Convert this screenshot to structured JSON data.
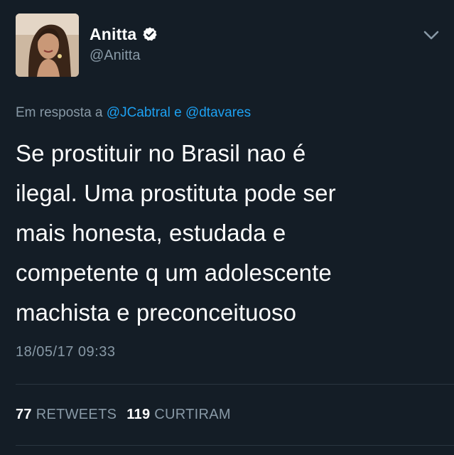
{
  "author": {
    "display_name": "Anitta",
    "handle": "@Anitta",
    "verified_icon": "verified-badge-icon",
    "avatar": "profile-photo"
  },
  "menu_icon": "chevron-down-icon",
  "reply": {
    "prefix": "Em resposta a ",
    "mention_1": "@JCabtral",
    "conjunction": " e ",
    "mention_2": "@dtavares"
  },
  "tweet": {
    "lines": [
      "Se prostituir no Brasil nao é",
      "ilegal. Uma prostituta pode ser",
      "mais honesta, estudada e",
      "competente q um adolescente",
      "machista e preconceituoso"
    ],
    "timestamp": "18/05/17 09:33"
  },
  "stats": {
    "retweets_count": "77",
    "retweets_label": "RETWEETS",
    "likes_count": "119",
    "likes_label": "CURTIRAM"
  },
  "colors": {
    "background": "#141d26",
    "text_primary": "#ffffff",
    "text_secondary": "#8899a6",
    "link": "#1da1f2",
    "divider": "#2a3540"
  }
}
